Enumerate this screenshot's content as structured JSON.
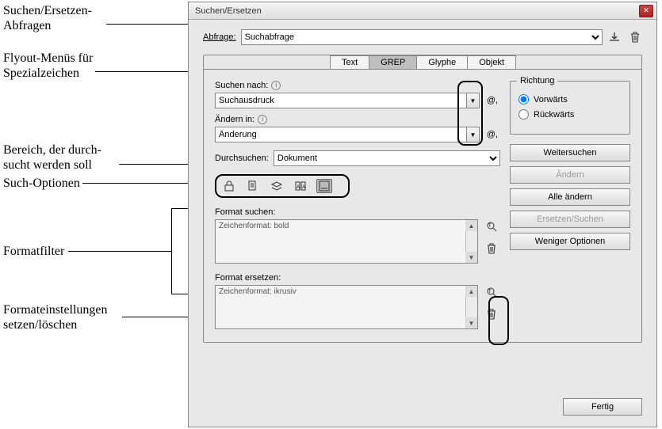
{
  "annotations": {
    "queries": "Suchen/Ersetzen-\nAbfragen",
    "flyout": "Flyout-Menüs für\nSpezialzeichen",
    "scope": "Bereich, der durch-\nsucht werden soll",
    "options": "Such-Optionen",
    "filter": "Formatfilter",
    "settings": "Formateinstellungen\nsetzen/löschen"
  },
  "window": {
    "title": "Suchen/Ersetzen"
  },
  "query": {
    "label": "Abfrage:",
    "value": "Suchabfrage"
  },
  "tabs": {
    "text": "Text",
    "grep": "GREP",
    "glyph": "Glyphe",
    "object": "Objekt"
  },
  "search": {
    "label": "Suchen nach:",
    "value": "Suchausdruck",
    "at": "@,"
  },
  "change": {
    "label": "Ändern in:",
    "value": "Änderung",
    "at": "@,"
  },
  "scope": {
    "label": "Durchsuchen:",
    "value": "Dokument"
  },
  "format_search": {
    "label": "Format suchen:",
    "value": "Zeichenformat: bold"
  },
  "format_replace": {
    "label": "Format ersetzen:",
    "value": "Zeichenformat: ikrusiv"
  },
  "direction": {
    "legend": "Richtung",
    "forward": "Vorwärts",
    "backward": "Rückwärts"
  },
  "buttons": {
    "next": "Weitersuchen",
    "change": "Ăndern",
    "change_all": "Alle ändern",
    "replace_find": "Ersetzen/Suchen",
    "less_options": "Weniger Optionen",
    "done": "Fertig"
  },
  "icons": {
    "save": "⤓",
    "trash": "🗑",
    "magnify": "🔍",
    "info": "i"
  }
}
